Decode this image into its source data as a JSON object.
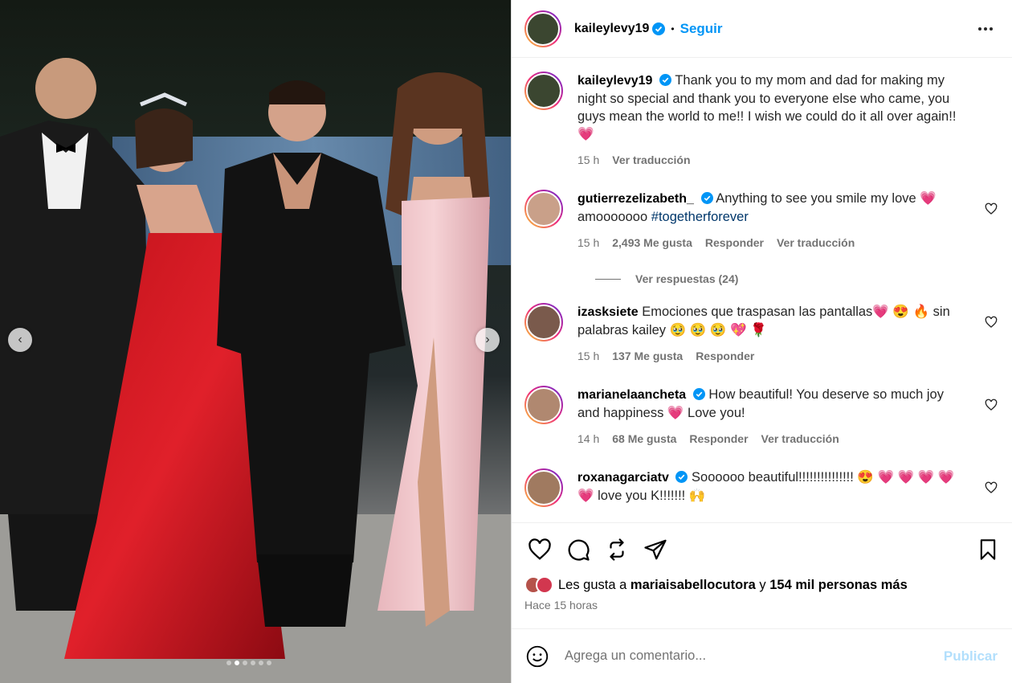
{
  "post": {
    "author": "kaileylevy19",
    "separator": "•",
    "follow_label": "Seguir"
  },
  "caption": {
    "username": "kaileylevy19",
    "text": "Thank you to my mom and dad for making my night so special and thank you to everyone else who came, you guys mean the world to me!! I wish we could do it all over again!!",
    "emoji": "💗",
    "time": "15 h",
    "translate": "Ver traducción"
  },
  "comments": [
    {
      "username": "gutierrezelizabeth_",
      "text": "Anything to see you smile my love 💗 amooooooo",
      "hashtag": "#togetherforever",
      "time": "15 h",
      "likes": "2,493 Me gusta",
      "reply": "Responder",
      "translate": "Ver traducción",
      "view_replies": "Ver respuestas (24)"
    },
    {
      "username": "izasksiete",
      "text": "Emociones que traspasan las pantallas💗 😍 🔥 sin palabras kailey 🥹 🥹 🥹 💖 🌹",
      "time": "15 h",
      "likes": "137 Me gusta",
      "reply": "Responder"
    },
    {
      "username": "marianelaancheta",
      "text": "How beautiful! You deserve so much joy and happiness 💗 Love you!",
      "time": "14 h",
      "likes": "68 Me gusta",
      "reply": "Responder",
      "translate": "Ver traducción"
    },
    {
      "username": "roxanagarciatv",
      "text": "Soooooo beautiful!!!!!!!!!!!!!!! 😍 💗 💗 💗 💗 💗 love you K!!!!!!! 🙌"
    }
  ],
  "likes": {
    "prefix": "Les gusta a",
    "user": "mariaisabellocutora",
    "connector": "y",
    "others": "154 mil personas más"
  },
  "timestamp": "Hace 15 horas",
  "comment_box": {
    "placeholder": "Agrega un comentario...",
    "publish_label": "Publicar"
  },
  "carousel": {
    "total": 6,
    "active": 1
  },
  "colors": {
    "accent": "#0095f6",
    "verified": "#0095f6",
    "heart": "#e8245d",
    "publish_disabled": "#b2dffc",
    "muted": "#737373"
  }
}
